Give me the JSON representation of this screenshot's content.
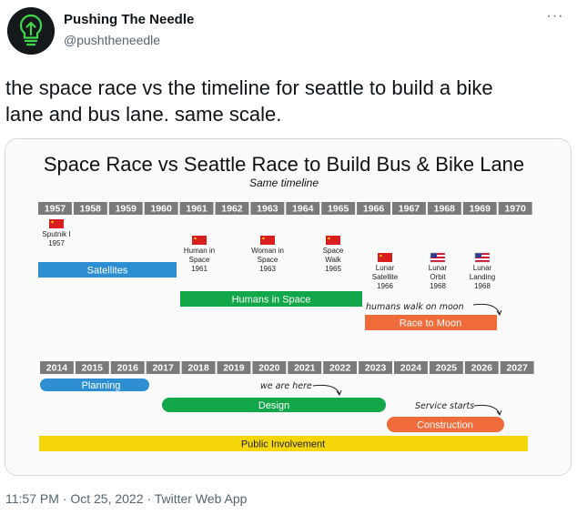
{
  "tweet": {
    "author_name": "Pushing The Needle",
    "author_handle": "@pushtheneedle",
    "more_icon": "more-dots-icon",
    "avatar_icon": "lightbulb-arrow-icon",
    "text_line1": "the space race vs the timeline for seattle to build a bike",
    "text_line2": "lane and bus lane. same scale.",
    "time": "11:57 PM",
    "separator": "·",
    "date": "Oct 25, 2022",
    "source": "Twitter Web App"
  },
  "infographic": {
    "title": "Space Race vs Seattle Race to Build Bus & Bike Lane",
    "subtitle": "Same timeline",
    "space_years": [
      "1957",
      "1958",
      "1959",
      "1960",
      "1961",
      "1962",
      "1963",
      "1964",
      "1965",
      "1966",
      "1967",
      "1968",
      "1969",
      "1970"
    ],
    "seattle_years": [
      "2014",
      "2015",
      "2016",
      "2017",
      "2018",
      "2019",
      "2020",
      "2021",
      "2022",
      "2023",
      "2024",
      "2025",
      "2026",
      "2027"
    ],
    "milestones": [
      {
        "flag": "soviet-flag-icon",
        "line1": "Sputnik I",
        "line2": "1957",
        "line3": ""
      },
      {
        "flag": "soviet-flag-icon",
        "line1": "Human in",
        "line2": "Space",
        "line3": "1961"
      },
      {
        "flag": "soviet-flag-icon",
        "line1": "Woman in",
        "line2": "Space",
        "line3": "1963"
      },
      {
        "flag": "soviet-flag-icon",
        "line1": "Space",
        "line2": "Walk",
        "line3": "1965"
      },
      {
        "flag": "soviet-flag-icon",
        "line1": "Lunar",
        "line2": "Satellite",
        "line3": "1966"
      },
      {
        "flag": "us-flag-icon",
        "line1": "Lunar",
        "line2": "Orbit",
        "line3": "1968"
      },
      {
        "flag": "us-flag-icon",
        "line1": "Lunar",
        "line2": "Landing",
        "line3": "1968"
      }
    ],
    "space_bars": [
      {
        "label": "Satellites",
        "color": "#2d8fd2"
      },
      {
        "label": "Humans in Space",
        "color": "#12a84a"
      },
      {
        "label": "Race to Moon",
        "color": "#ef6b3a"
      }
    ],
    "seattle_bars": [
      {
        "label": "Planning",
        "color": "#2d8fd2"
      },
      {
        "label": "Design",
        "color": "#12a84a"
      },
      {
        "label": "Construction",
        "color": "#ef6b3a"
      },
      {
        "label": "Public Involvement",
        "color": "#f5d60a"
      }
    ],
    "notes": {
      "moon": "humans walk on moon",
      "here": "we are here",
      "service": "Service starts"
    }
  }
}
